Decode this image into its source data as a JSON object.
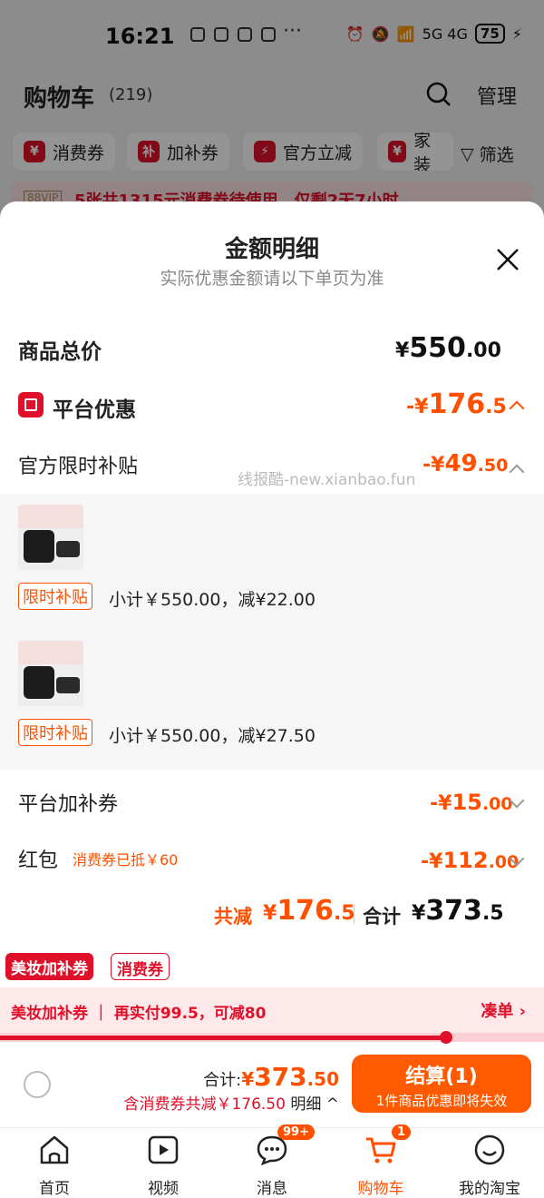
{
  "status_bar": {
    "time": "16:21",
    "dots": "···",
    "network": "5G 4G",
    "battery": "75"
  },
  "cart": {
    "title": "购物车",
    "count": "(219)",
    "manage_label": "管理"
  },
  "chips": [
    {
      "badge": "¥",
      "label": "消费券"
    },
    {
      "badge": "补",
      "label": "加补券"
    },
    {
      "badge": "⚡",
      "label": "官方立减"
    },
    {
      "badge": "¥",
      "label": "家装"
    }
  ],
  "filter_label": "筛选",
  "promo": {
    "vip": "88VIP",
    "text": "5张共1315元消费券待使用，仅剩2天7小时"
  },
  "sheet": {
    "title": "金额明细",
    "subtitle": "实际优惠金额请以下单页为准",
    "watermark": "线报酷-new.xianbao.fun",
    "goods_total": {
      "label": "商品总价",
      "sym": "¥",
      "int": "550",
      "dec": ".00"
    },
    "platform": {
      "label": "平台优惠",
      "sym": "-¥",
      "int": "176",
      "dec": ".5"
    },
    "subsidy": {
      "label": "官方限时补贴",
      "sym": "-¥",
      "int": "49",
      "dec": ".50"
    },
    "items": [
      {
        "tag": "限时补贴",
        "subtotal": "小计￥550.00，减¥22.00"
      },
      {
        "tag": "限时补贴",
        "subtotal": "小计￥550.00，减¥27.50"
      }
    ],
    "plat_coupon": {
      "label": "平台加补券",
      "sym": "-¥",
      "int": "15",
      "dec": ".00"
    },
    "red_packet": {
      "label": "红包",
      "note": "消费券已抵￥60",
      "sym": "-¥",
      "int": "112",
      "dec": ".00"
    },
    "summary": {
      "saved_label": "共减",
      "saved_sym": "¥",
      "saved_int": "176",
      "saved_dec": ".5",
      "total_label": "合计",
      "total_sym": "¥",
      "total_int": "373",
      "total_dec": ".5"
    }
  },
  "makeup": {
    "tag1": "美妆加补券",
    "tag2": "消费券",
    "bar_text": "美妆加补券 ｜ 再实付99.5，可减80",
    "bar_action": "凑单 ›",
    "progress": 0.82
  },
  "checkout": {
    "total_label": "合计:",
    "total_sym": "¥",
    "total_int": "373",
    "total_dec": ".50",
    "saving": "含消费券共减￥176.50",
    "detail": "明细 ^",
    "button_label": "结算(1)",
    "button_sub": "1件商品优惠即将失效"
  },
  "tabs": [
    {
      "label": "首页",
      "icon": "home-icon"
    },
    {
      "label": "视频",
      "icon": "video-icon"
    },
    {
      "label": "消息",
      "icon": "message-icon",
      "badge": "99+"
    },
    {
      "label": "购物车",
      "icon": "cart-icon",
      "badge": "1",
      "active": true
    },
    {
      "label": "我的淘宝",
      "icon": "profile-icon"
    }
  ],
  "colors": {
    "accent": "#ff5000",
    "brand_red": "#e0102a"
  }
}
